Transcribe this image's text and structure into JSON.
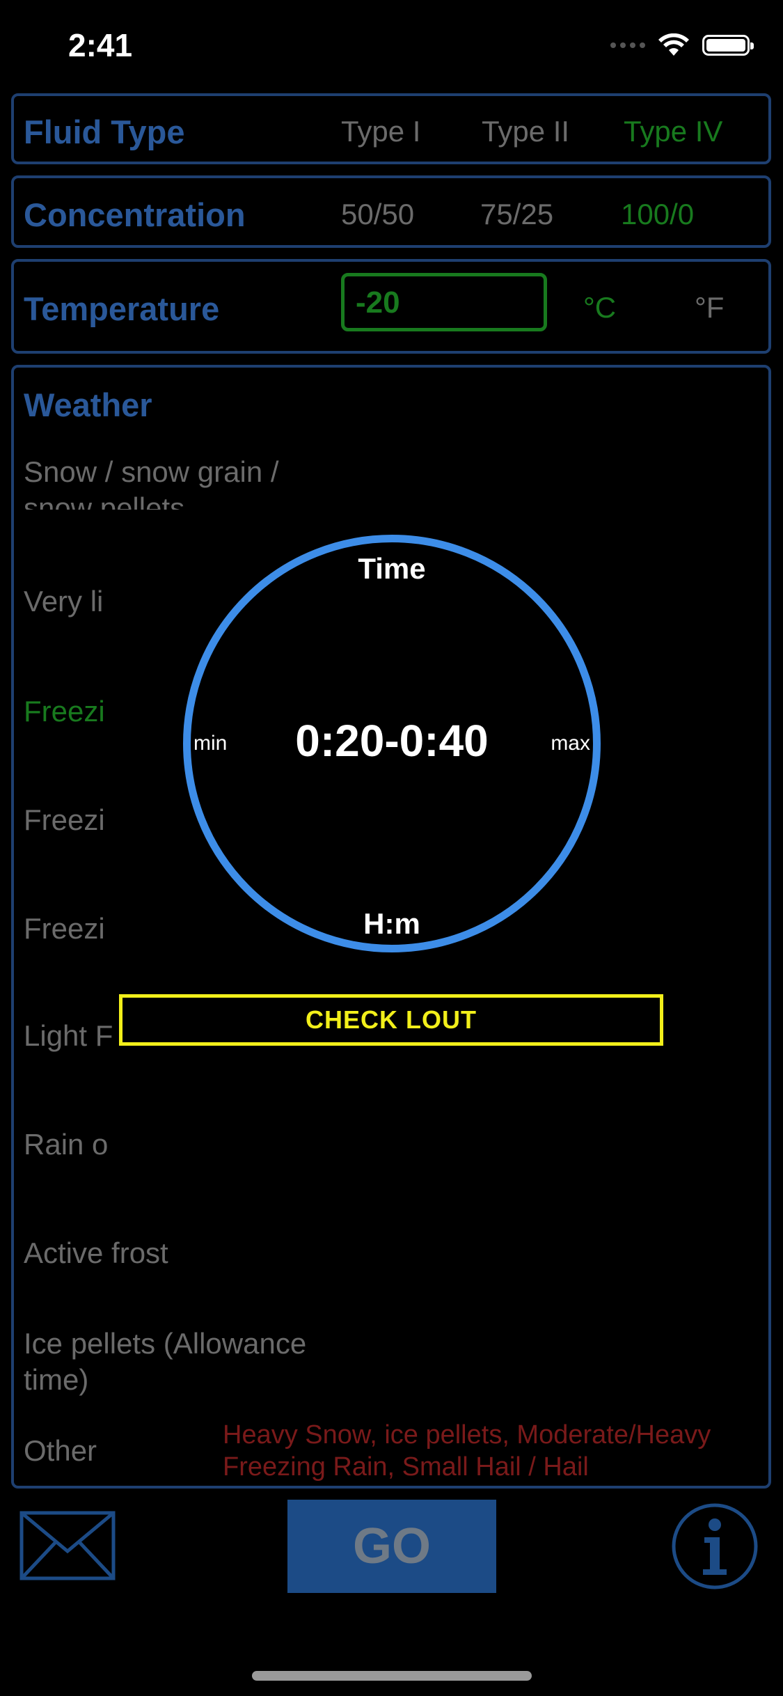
{
  "status_bar": {
    "time": "2:41"
  },
  "fluid_type": {
    "label": "Fluid Type",
    "options": [
      "Type I",
      "Type II",
      "Type IV"
    ],
    "selected_index": 2
  },
  "concentration": {
    "label": "Concentration",
    "options": [
      "50/50",
      "75/25",
      "100/0"
    ],
    "selected_index": 2
  },
  "temperature": {
    "label": "Temperature",
    "value": "-20",
    "units": [
      "°C",
      "°F"
    ],
    "selected_unit_index": 0
  },
  "weather": {
    "label": "Weather",
    "items": [
      "Snow / snow grain / snow pellets",
      "Very li",
      "Freezi",
      "Freezi",
      "Freezi",
      "Light F",
      "Rain o",
      "Active frost",
      "Ice pellets (Allowance time)",
      "Other"
    ],
    "selected_index": 2,
    "other_note": "Heavy Snow, ice pellets, Moderate/Heavy Freezing Rain, Small Hail / Hail"
  },
  "overlay": {
    "top_label": "Time",
    "value": "0:20-0:40",
    "left_label": "min",
    "right_label": "max",
    "bottom_label": "H:m",
    "check_button": "CHECK LOUT"
  },
  "toolbar": {
    "mail_icon": "mail-icon",
    "go_label": "GO",
    "info_icon": "info-icon"
  },
  "colors": {
    "label_blue": "#2a5899",
    "border_blue": "#1e3f70",
    "selected_green": "#187a1e",
    "ring_blue": "#3d8de8",
    "check_yellow": "#f2ef1a",
    "warning_red": "#7a1a1a"
  }
}
